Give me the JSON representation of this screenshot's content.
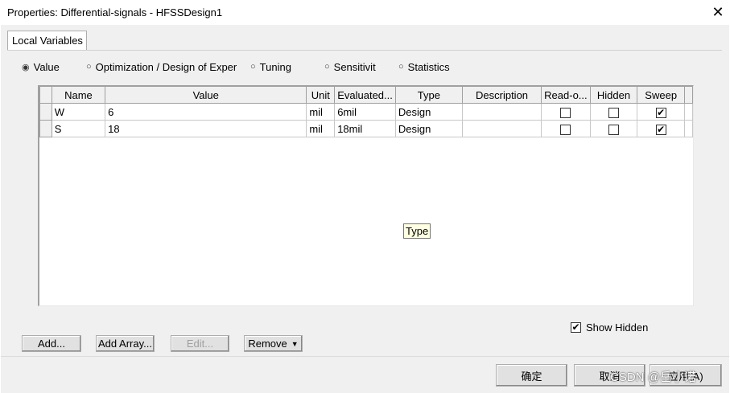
{
  "window": {
    "title": "Properties: Differential-signals - HFSSDesign1",
    "close_glyph": "✕"
  },
  "tabs": [
    {
      "label": "Local Variables"
    }
  ],
  "radio_options": [
    {
      "label": "Value",
      "selected": true
    },
    {
      "label": "Optimization / Design of Exper",
      "selected": false
    },
    {
      "label": "Tuning",
      "selected": false
    },
    {
      "label": "Sensitivit",
      "selected": false
    },
    {
      "label": "Statistics",
      "selected": false
    }
  ],
  "table": {
    "columns": [
      "Name",
      "Value",
      "Unit",
      "Evaluated...",
      "Type",
      "Description",
      "Read-o...",
      "Hidden",
      "Sweep"
    ],
    "rows": [
      {
        "name": "W",
        "value": "6",
        "unit": "mil",
        "evaluated": "6mil",
        "type": "Design",
        "description": "",
        "read_only": false,
        "hidden": false,
        "sweep": true
      },
      {
        "name": "S",
        "value": "18",
        "unit": "mil",
        "evaluated": "18mil",
        "type": "Design",
        "description": "",
        "read_only": false,
        "hidden": false,
        "sweep": true
      }
    ]
  },
  "tooltip": "Type",
  "show_hidden": {
    "label": "Show Hidden",
    "checked": true
  },
  "buttons": {
    "add": "Add...",
    "add_array": "Add Array...",
    "edit": "Edit...",
    "remove": "Remove",
    "ok": "确定",
    "cancel": "取消",
    "apply": "应用(A)"
  },
  "watermark": "CSDN @岳小诺",
  "icons": {
    "close": "close-icon",
    "radio": "radio-icon",
    "checkbox": "checkbox-icon",
    "dropdown": "dropdown-arrow-icon"
  }
}
